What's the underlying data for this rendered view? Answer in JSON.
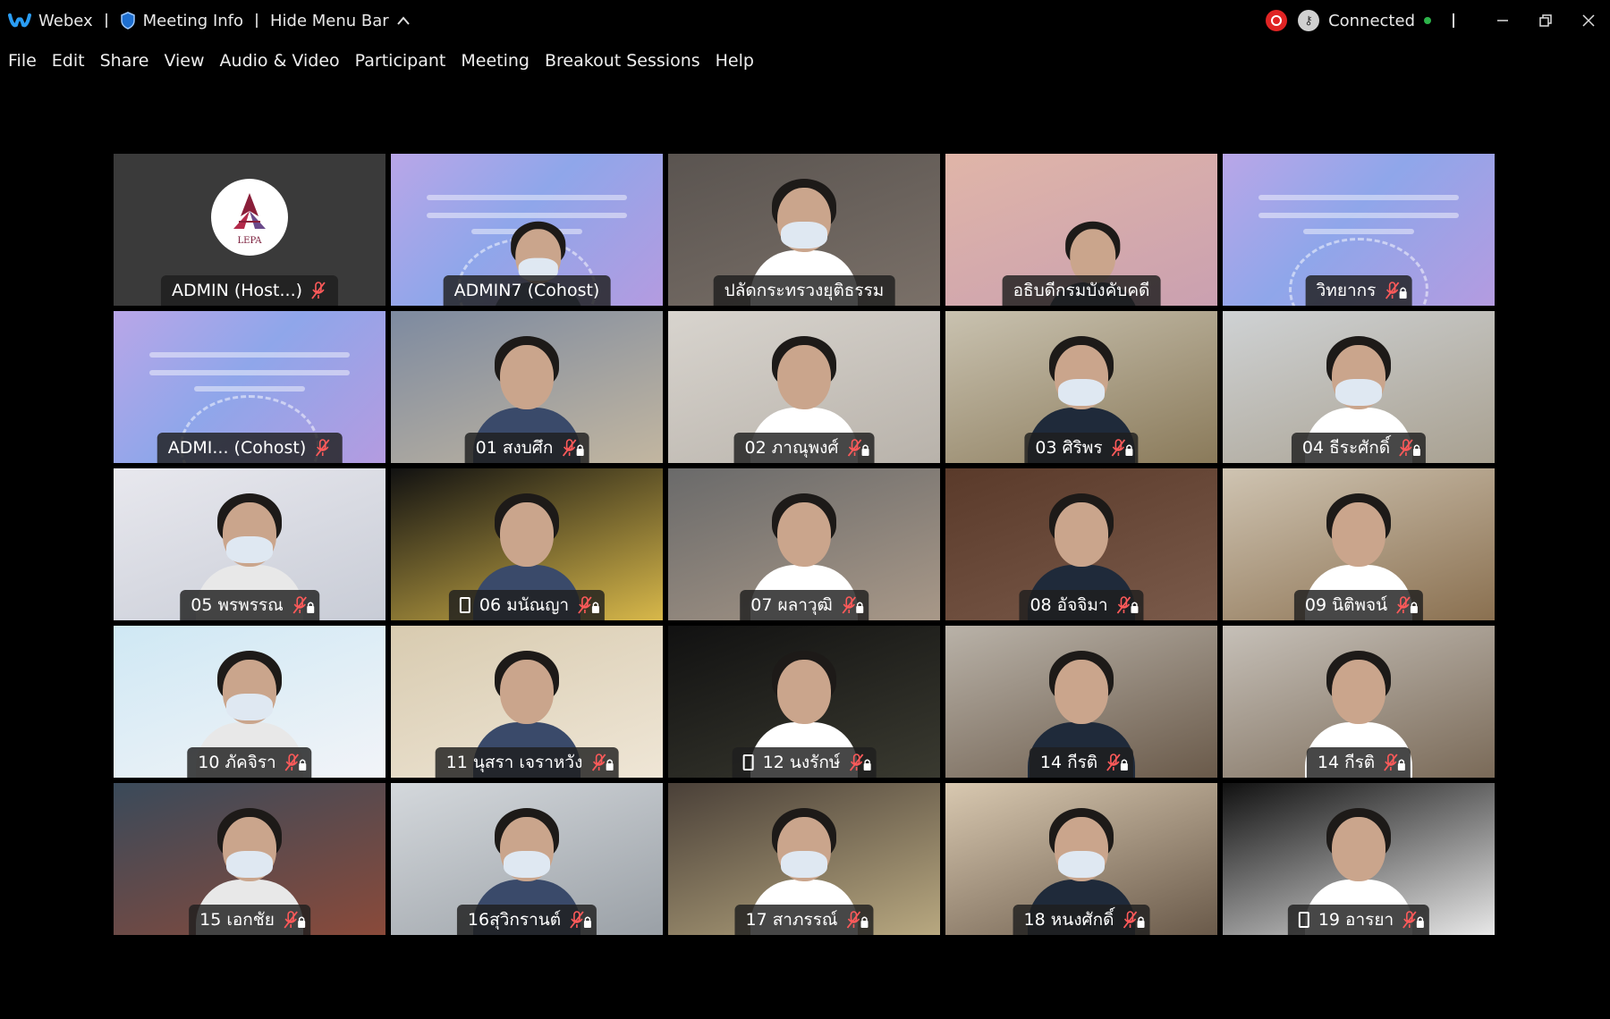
{
  "titlebar": {
    "app_name": "Webex",
    "meeting_info": "Meeting Info",
    "hide_menu_bar": "Hide Menu Bar",
    "connection_status": "Connected",
    "colors": {
      "record": "#e02424",
      "connected_dot": "#2db34a",
      "active_speaker": "#1fb5f2"
    }
  },
  "menubar": {
    "items": [
      "File",
      "Edit",
      "Share",
      "View",
      "Audio & Video",
      "Participant",
      "Meeting",
      "Breakout Sessions",
      "Help"
    ]
  },
  "tiles": [
    {
      "name": "ADMIN  (Host...)",
      "type": "logo",
      "mic": "muted-red",
      "device": false,
      "logo_text": "LEPA"
    },
    {
      "name": "ADMIN7  (Cohost)",
      "type": "person-slide",
      "mic": "none",
      "device": false,
      "active": true
    },
    {
      "name": "ปลัดกระทรวงยุติธรรม",
      "type": "person",
      "mic": "none",
      "device": false
    },
    {
      "name": "อธิบดีกรมบังคับคดี",
      "type": "person-slide",
      "mic": "none",
      "device": false
    },
    {
      "name": "วิทยากร",
      "type": "slide",
      "mic": "muted-locked",
      "device": false
    },
    {
      "name": "ADMI...  (Cohost)",
      "type": "slide",
      "mic": "muted-red",
      "device": false
    },
    {
      "name": "01 สงบศึก",
      "type": "person",
      "mic": "muted-locked",
      "device": false
    },
    {
      "name": "02 ภาณุพงศ์",
      "type": "person",
      "mic": "muted-locked",
      "device": false
    },
    {
      "name": "03 ศิริพร",
      "type": "person",
      "mic": "muted-locked",
      "device": false
    },
    {
      "name": "04 ธีระศักดิ์",
      "type": "person",
      "mic": "muted-locked",
      "device": false
    },
    {
      "name": "05 พรพรรณ",
      "type": "person",
      "mic": "muted-locked",
      "device": false
    },
    {
      "name": "06 มนัณญา",
      "type": "person",
      "mic": "muted-locked",
      "device": true
    },
    {
      "name": "07 ผลาวุฒิ",
      "type": "person",
      "mic": "muted-locked",
      "device": false
    },
    {
      "name": "08 อัจจิมา",
      "type": "person",
      "mic": "muted-locked",
      "device": false
    },
    {
      "name": "09 นิติพจน์",
      "type": "person",
      "mic": "muted-locked",
      "device": false
    },
    {
      "name": "10 ภัคจิรา",
      "type": "person",
      "mic": "muted-locked",
      "device": false
    },
    {
      "name": "11 นุสรา เจราหวัง",
      "type": "person",
      "mic": "muted-locked",
      "device": false
    },
    {
      "name": "12 นงรักษ์",
      "type": "person",
      "mic": "muted-locked",
      "device": true
    },
    {
      "name": "14 กีรติ",
      "type": "person",
      "mic": "muted-locked",
      "device": false
    },
    {
      "name": "14 กีรติ",
      "type": "person",
      "mic": "muted-locked",
      "device": false
    },
    {
      "name": "15 เอกชัย",
      "type": "person",
      "mic": "muted-locked",
      "device": false
    },
    {
      "name": "16สุวิกรานต์",
      "type": "person",
      "mic": "muted-locked",
      "device": false
    },
    {
      "name": "17 สาภรรณ์",
      "type": "person",
      "mic": "muted-locked",
      "device": false
    },
    {
      "name": "18 หนงศักดิ์",
      "type": "person",
      "mic": "muted-locked",
      "device": false
    },
    {
      "name": "19 อารยา",
      "type": "person",
      "mic": "muted-locked",
      "device": true
    }
  ]
}
